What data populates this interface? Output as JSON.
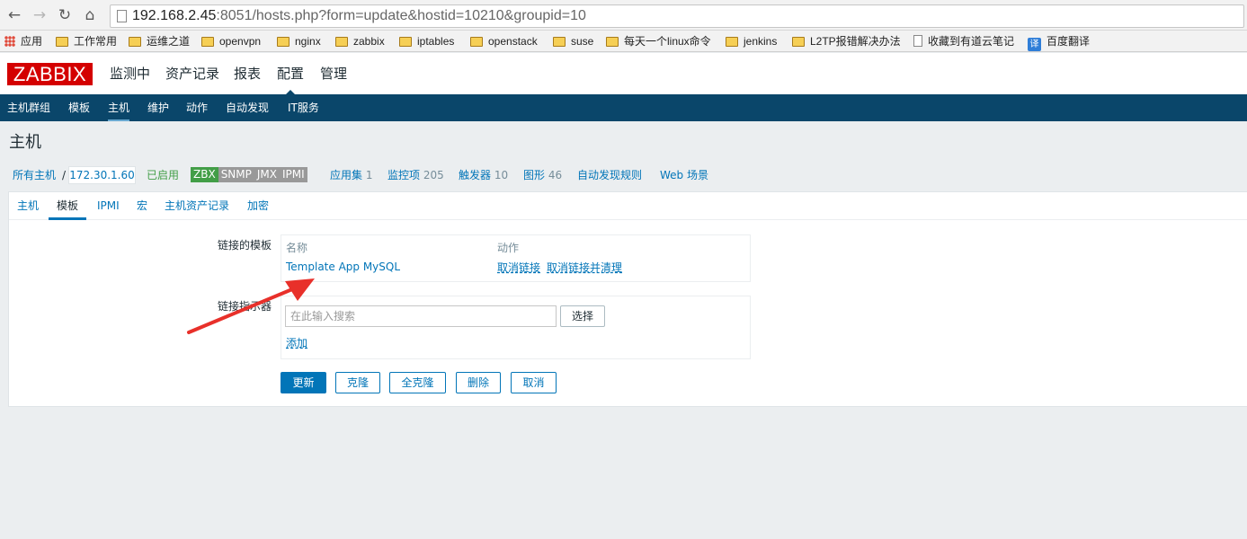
{
  "browser": {
    "url_host": "192.168.2.45",
    "url_rest": ":8051/hosts.php?form=update&hostid=10210&groupid=10",
    "bookmarks": [
      "应用",
      "工作常用",
      "运维之道",
      "openvpn",
      "nginx",
      "zabbix",
      "iptables",
      "openstack",
      "suse",
      "每天一个linux命令",
      "jenkins",
      "L2TP报错解决办法",
      "收藏到有道云笔记",
      "百度翻译"
    ]
  },
  "header": {
    "logo": "ZABBIX",
    "menu": [
      "监测中",
      "资产记录",
      "报表",
      "配置",
      "管理"
    ]
  },
  "subnav": [
    "主机群组",
    "模板",
    "主机",
    "维护",
    "动作",
    "自动发现",
    "IT服务"
  ],
  "page": {
    "title": "主机",
    "all_hosts": "所有主机",
    "separator": "/",
    "host": "172.30.1.60",
    "status": "已启用",
    "availability": [
      "ZBX",
      "SNMP",
      "JMX",
      "IPMI"
    ],
    "apps_label": "应用集",
    "apps_count": "1",
    "items_label": "监控项",
    "items_count": "205",
    "triggers_label": "触发器",
    "triggers_count": "10",
    "graphs_label": "图形",
    "graphs_count": "46",
    "discovery": "自动发现规则",
    "web": "Web 场景"
  },
  "tabs": [
    "主机",
    "模板",
    "IPMI",
    "宏",
    "主机资产记录",
    "加密"
  ],
  "form": {
    "linked_label": "链接的模板",
    "col_name": "名称",
    "col_action": "动作",
    "template_name": "Template App MySQL",
    "unlink": "取消链接",
    "unlink_clear": "取消链接并清理",
    "linker_label": "链接指示器",
    "search_placeholder": "在此输入搜索",
    "select_btn": "选择",
    "add_link": "添加"
  },
  "buttons": {
    "update": "更新",
    "clone": "克隆",
    "full_clone": "全克隆",
    "delete": "删除",
    "cancel": "取消"
  },
  "colors": {
    "brand_red": "#d40000",
    "nav_blue": "#0a466a",
    "link": "#0275b8",
    "enabled_green": "#429e47",
    "arrow_red": "#e8302a"
  }
}
